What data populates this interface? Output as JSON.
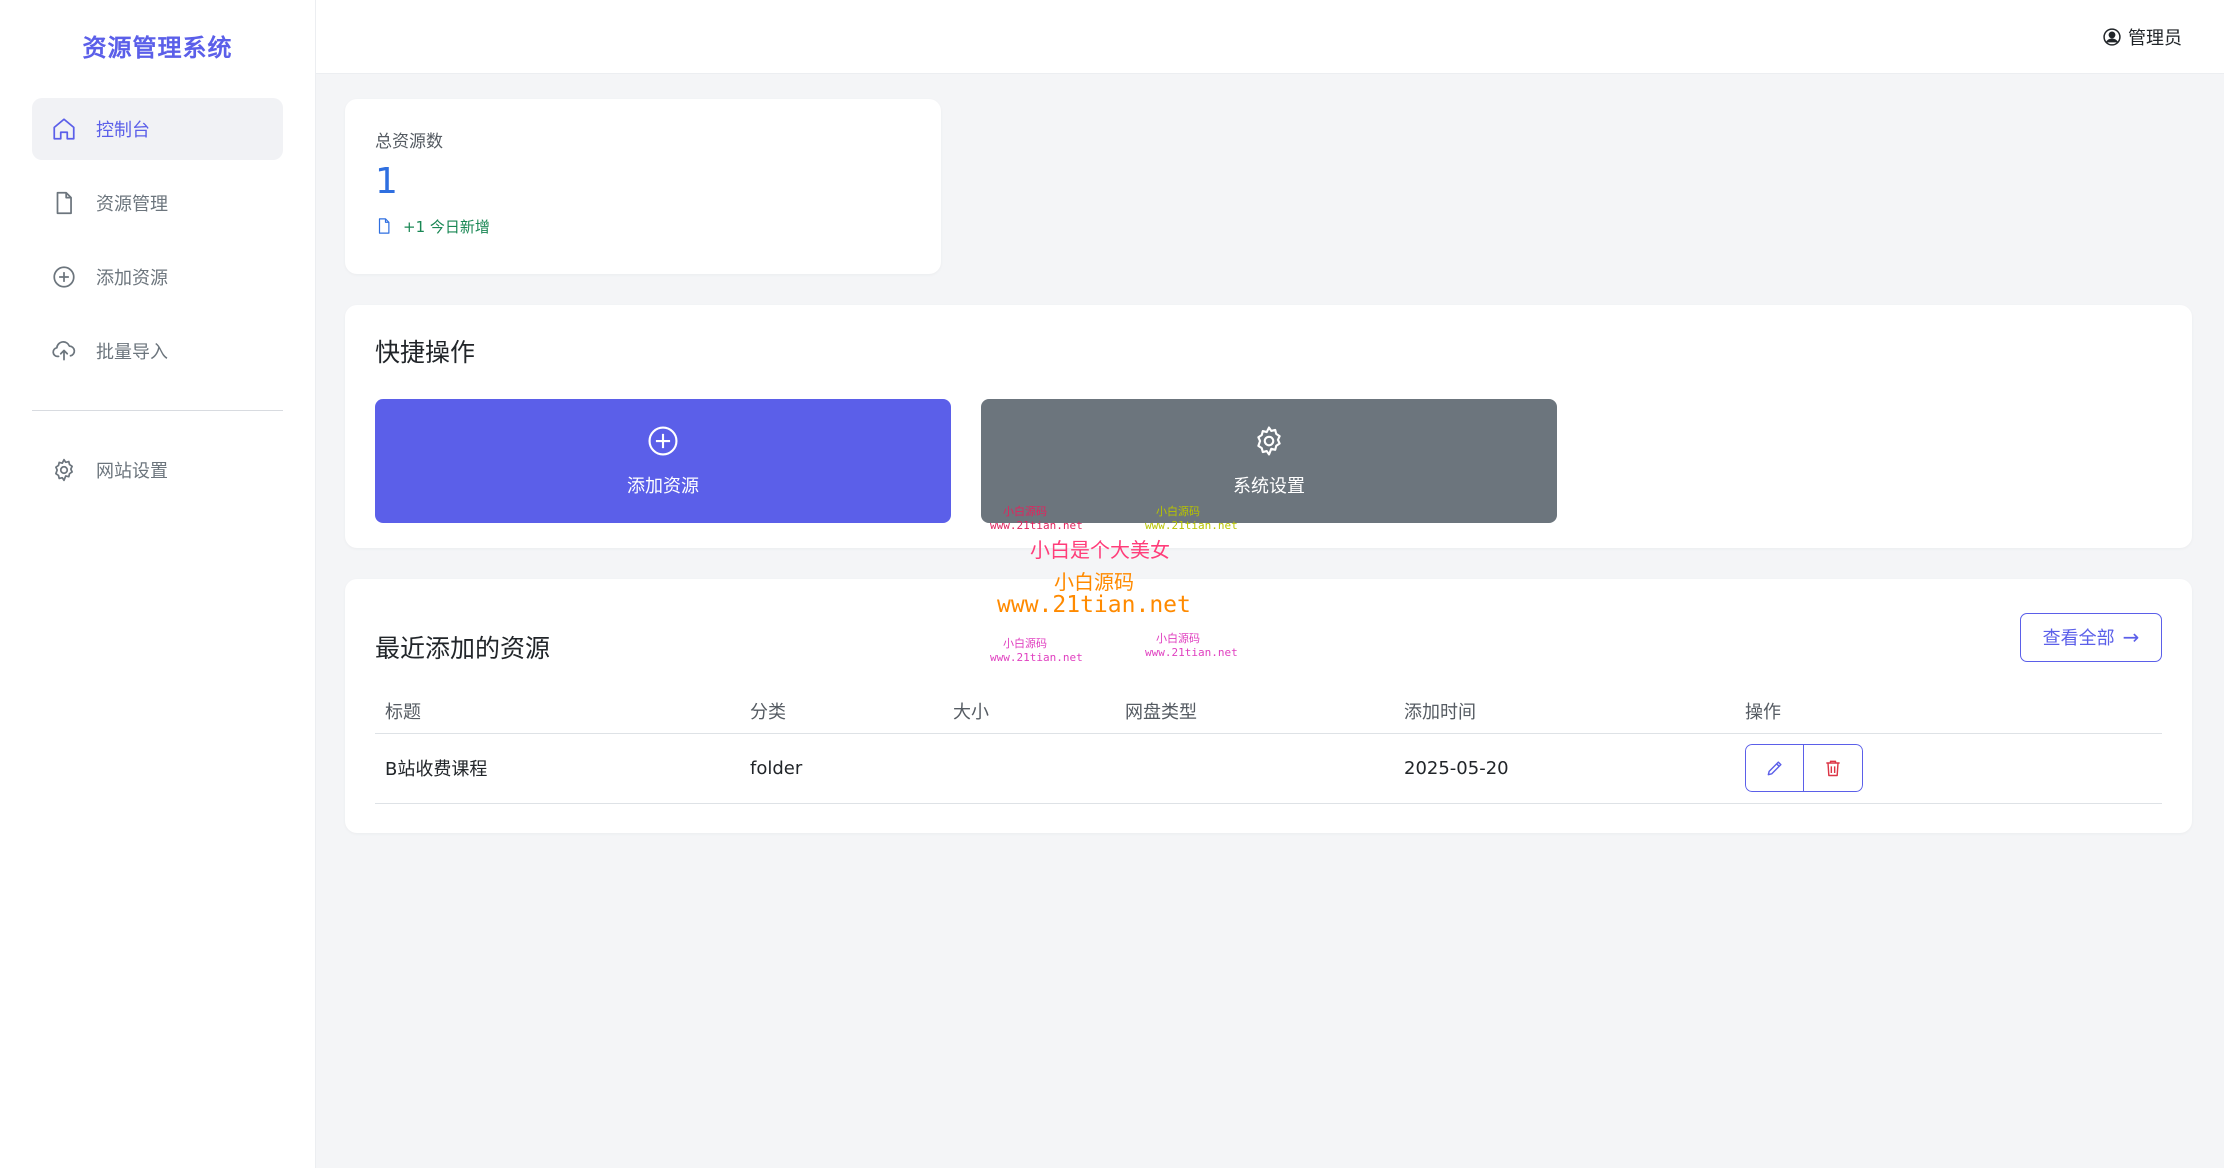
{
  "app": {
    "title": "资源管理系统",
    "accent": "#5b5fe9"
  },
  "sidebar": {
    "items": [
      {
        "label": "控制台",
        "icon": "home-icon",
        "active": true
      },
      {
        "label": "资源管理",
        "icon": "file-icon"
      },
      {
        "label": "添加资源",
        "icon": "plus-circle-icon"
      },
      {
        "label": "批量导入",
        "icon": "cloud-upload-icon"
      }
    ],
    "settings": {
      "label": "网站设置",
      "icon": "gear-icon"
    }
  },
  "header": {
    "user": "管理员",
    "user_icon": "user-circle-icon"
  },
  "stats": {
    "label": "总资源数",
    "value": "1",
    "sub": "+1 今日新增"
  },
  "quick": {
    "title": "快捷操作",
    "add": {
      "label": "添加资源",
      "icon": "plus-circle-icon",
      "color": "#5b5fe9"
    },
    "settings": {
      "label": "系统设置",
      "icon": "gear-icon",
      "color": "#6c757d"
    }
  },
  "recent": {
    "title": "最近添加的资源",
    "view_all": "查看全部",
    "columns": [
      "标题",
      "分类",
      "大小",
      "网盘类型",
      "添加时间",
      "操作"
    ],
    "rows": [
      {
        "title": "B站收费课程",
        "category": "folder",
        "size": "",
        "disk": "",
        "date": "2025-05-20"
      }
    ]
  },
  "watermark": {
    "lines": [
      "小白源码",
      "www.21tian.net",
      "小白是个大美女",
      "小白源码",
      "www.21tian.net",
      "小白源码",
      "www.21tian.net",
      "小白源码",
      "www.21tian.net",
      "小白源码",
      "www.21tian.net"
    ]
  }
}
